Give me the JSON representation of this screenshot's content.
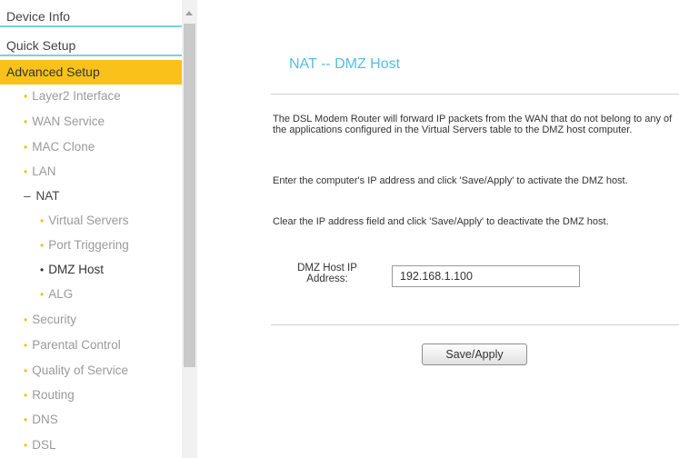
{
  "sidebar": {
    "top_items": [
      "Device Info",
      "Quick Setup",
      "Advanced Setup"
    ],
    "sub_items": [
      "Layer2 Interface",
      "WAN Service",
      "MAC Clone",
      "LAN",
      "NAT",
      "Virtual Servers",
      "Port Triggering",
      "DMZ Host",
      "ALG",
      "Security",
      "Parental Control",
      "Quality of Service",
      "Routing",
      "DNS",
      "DSL"
    ],
    "colors": {
      "highlight": "#f8c21a",
      "bullet": "#f2c010",
      "divider": "#7fcde8"
    }
  },
  "main": {
    "title": "NAT -- DMZ Host",
    "para1": "The DSL Modem Router will forward IP packets from the WAN that do not belong to any of the applications configured in the Virtual Servers table to the DMZ host computer.",
    "para2": "Enter the computer's IP address and click 'Save/Apply' to activate the DMZ host.",
    "para3": "Clear the IP address field and click 'Save/Apply' to deactivate the DMZ host.",
    "host_label_line1": "DMZ Host IP",
    "host_label_line2": "Address:",
    "host_value": "192.168.1.100",
    "save_label": "Save/Apply",
    "colors": {
      "title": "#54bde4"
    }
  }
}
